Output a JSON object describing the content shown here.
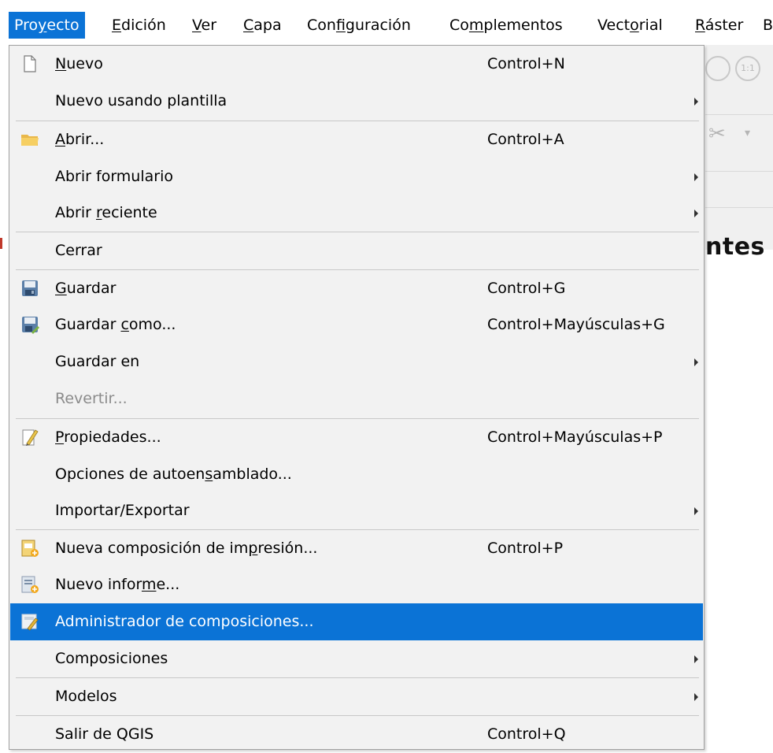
{
  "menubar": {
    "items": [
      {
        "pre": "Pro",
        "u": "y",
        "post": "ecto",
        "active": true
      },
      {
        "pre": "",
        "u": "E",
        "post": "dición",
        "active": false
      },
      {
        "pre": "",
        "u": "V",
        "post": "er",
        "active": false
      },
      {
        "pre": "",
        "u": "C",
        "post": "apa",
        "active": false
      },
      {
        "pre": "Con",
        "u": "f",
        "post": "iguración",
        "active": false
      },
      {
        "pre": "Co",
        "u": "m",
        "post": "plementos",
        "active": false
      },
      {
        "pre": "Vect",
        "u": "o",
        "post": "rial",
        "active": false
      },
      {
        "pre": "",
        "u": "R",
        "post": "áster",
        "active": false
      },
      {
        "pre": "B",
        "u": "",
        "post": "",
        "active": false
      }
    ]
  },
  "background": {
    "panel_title": "ntes",
    "zoom_label": "1:1"
  },
  "menu": {
    "items": [
      {
        "pre": "",
        "u": "N",
        "post": "uevo",
        "shortcut": "Control+N",
        "icon": "new-page-icon"
      },
      {
        "pre": "Nuevo usando plantilla",
        "u": "",
        "post": "",
        "submenu": true
      },
      {
        "sep": true
      },
      {
        "pre": "",
        "u": "A",
        "post": "brir...",
        "shortcut": "Control+A",
        "icon": "folder-open-icon"
      },
      {
        "pre": "Abrir formulario",
        "u": "",
        "post": "",
        "submenu": true
      },
      {
        "pre": "Abrir ",
        "u": "r",
        "post": "eciente",
        "submenu": true
      },
      {
        "sep": true
      },
      {
        "pre": "Cerrar",
        "u": "",
        "post": ""
      },
      {
        "sep": true
      },
      {
        "pre": "",
        "u": "G",
        "post": "uardar",
        "shortcut": "Control+G",
        "icon": "save-icon"
      },
      {
        "pre": "Guardar ",
        "u": "c",
        "post": "omo...",
        "shortcut": "Control+Mayúsculas+G",
        "icon": "save-as-icon"
      },
      {
        "pre": "Guardar en",
        "u": "",
        "post": "",
        "submenu": true
      },
      {
        "pre": "Revertir...",
        "u": "",
        "post": "",
        "disabled": true
      },
      {
        "sep": true
      },
      {
        "pre": "",
        "u": "P",
        "post": "ropiedades...",
        "shortcut": "Control+Mayúsculas+P",
        "icon": "properties-icon"
      },
      {
        "pre": "Opciones de autoen",
        "u": "s",
        "post": "amblado..."
      },
      {
        "pre": "Importar/Exportar",
        "u": "",
        "post": "",
        "submenu": true
      },
      {
        "sep": true
      },
      {
        "pre": "Nueva composición de im",
        "u": "p",
        "post": "resión...",
        "shortcut": "Control+P",
        "icon": "new-layout-icon"
      },
      {
        "pre": "Nuevo infor",
        "u": "m",
        "post": "e...",
        "icon": "new-report-icon"
      },
      {
        "pre": "Administrador de composiciones...",
        "u": "",
        "post": "",
        "icon": "layout-manager-icon",
        "hover": true
      },
      {
        "pre": "Composiciones",
        "u": "",
        "post": "",
        "submenu": true
      },
      {
        "sep": true
      },
      {
        "pre": "Modelos",
        "u": "",
        "post": "",
        "submenu": true
      },
      {
        "sep": true
      },
      {
        "pre": "Salir de QGIS",
        "u": "",
        "post": "",
        "shortcut": "Control+Q"
      }
    ]
  },
  "colors": {
    "accent": "#0b73d6",
    "menu_bg": "#f2f2f2",
    "disabled_text": "#8b8b8b"
  }
}
